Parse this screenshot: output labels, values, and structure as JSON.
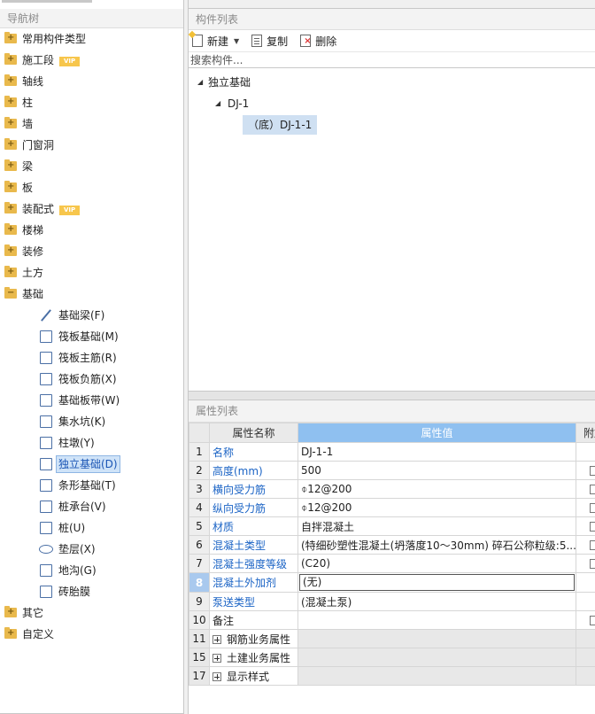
{
  "nav_panel": {
    "title": "导航树",
    "items": [
      {
        "label": "常用构件类型",
        "vip": ""
      },
      {
        "label": "施工段",
        "vip": "VIP"
      },
      {
        "label": "轴线",
        "vip": ""
      },
      {
        "label": "柱",
        "vip": ""
      },
      {
        "label": "墙",
        "vip": ""
      },
      {
        "label": "门窗洞",
        "vip": ""
      },
      {
        "label": "梁",
        "vip": ""
      },
      {
        "label": "板",
        "vip": ""
      },
      {
        "label": "装配式",
        "vip": "VIP"
      },
      {
        "label": "楼梯",
        "vip": ""
      },
      {
        "label": "装修",
        "vip": ""
      },
      {
        "label": "土方",
        "vip": ""
      },
      {
        "label": "基础",
        "vip": ""
      }
    ],
    "foundation_children": [
      {
        "label": "基础梁(F)",
        "icon": "beam-icon"
      },
      {
        "label": "筏板基础(M)",
        "icon": "raft-foundation-icon"
      },
      {
        "label": "筏板主筋(R)",
        "icon": "raft-main-rebar-icon"
      },
      {
        "label": "筏板负筋(X)",
        "icon": "raft-negative-rebar-icon"
      },
      {
        "label": "基础板带(W)",
        "icon": "foundation-strip-icon"
      },
      {
        "label": "集水坑(K)",
        "icon": "sump-pit-icon"
      },
      {
        "label": "柱墩(Y)",
        "icon": "column-pier-icon"
      },
      {
        "label": "独立基础(D)",
        "icon": "isolated-footing-icon"
      },
      {
        "label": "条形基础(T)",
        "icon": "strip-footing-icon"
      },
      {
        "label": "桩承台(V)",
        "icon": "pile-cap-icon"
      },
      {
        "label": "桩(U)",
        "icon": "pile-icon"
      },
      {
        "label": "垫层(X)",
        "icon": "cushion-layer-icon"
      },
      {
        "label": "地沟(G)",
        "icon": "trench-icon"
      },
      {
        "label": "砖胎膜",
        "icon": "brick-mold-icon"
      }
    ],
    "items_after": [
      {
        "label": "其它"
      },
      {
        "label": "自定义"
      }
    ]
  },
  "component_panel": {
    "title": "构件列表",
    "toolbar": {
      "new_label": "新建",
      "copy_label": "复制",
      "delete_label": "删除"
    },
    "search_placeholder": "搜索构件...",
    "tree": {
      "root": "独立基础",
      "child": "DJ-1",
      "leaf": "（底）DJ-1-1"
    }
  },
  "property_panel": {
    "title": "属性列表",
    "columns": {
      "name": "属性名称",
      "value": "属性值",
      "extra": "附加"
    },
    "rows": [
      {
        "num": "1",
        "name": "名称",
        "value": "DJ-1-1"
      },
      {
        "num": "2",
        "name": "高度(mm)",
        "value": "500"
      },
      {
        "num": "3",
        "name": "横向受力筋",
        "value": "⌽12@200"
      },
      {
        "num": "4",
        "name": "纵向受力筋",
        "value": "⌽12@200"
      },
      {
        "num": "5",
        "name": "材质",
        "value": "自拌混凝土"
      },
      {
        "num": "6",
        "name": "混凝土类型",
        "value": "(特细砂塑性混凝土(坍落度10～30mm) 碎石公称粒级:5..."
      },
      {
        "num": "7",
        "name": "混凝土强度等级",
        "value": "(C20)"
      },
      {
        "num": "8",
        "name": "混凝土外加剂",
        "value": "(无)"
      },
      {
        "num": "9",
        "name": "泵送类型",
        "value": "(混凝土泵)"
      },
      {
        "num": "10",
        "name": "备注",
        "value": ""
      }
    ],
    "groups": [
      {
        "num": "11",
        "name": "钢筋业务属性"
      },
      {
        "num": "15",
        "name": "土建业务属性"
      },
      {
        "num": "17",
        "name": "显示样式"
      }
    ]
  }
}
